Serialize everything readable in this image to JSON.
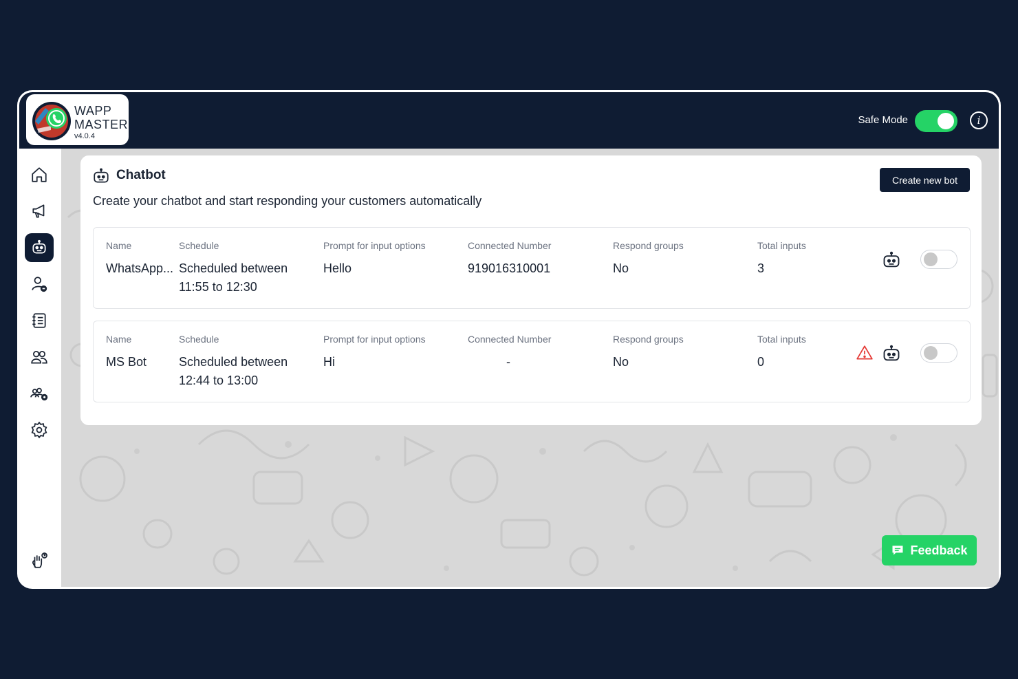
{
  "app": {
    "logo_line1": "WAPP",
    "logo_line2": "MASTER",
    "version": "v4.0.4",
    "safe_mode_label": "Safe Mode",
    "safe_mode_on": true
  },
  "sidebar": {
    "items": [
      {
        "icon": "home-icon",
        "active": false
      },
      {
        "icon": "megaphone-icon",
        "active": false
      },
      {
        "icon": "chatbot-icon",
        "active": true
      },
      {
        "icon": "user-minus-icon",
        "active": false
      },
      {
        "icon": "notebook-icon",
        "active": false
      },
      {
        "icon": "users-icon",
        "active": false
      },
      {
        "icon": "users-add-icon",
        "active": false
      },
      {
        "icon": "settings-icon",
        "active": false
      }
    ],
    "help_icon": "hand-help-icon"
  },
  "page": {
    "title": "Chatbot",
    "subtitle": "Create your chatbot and start responding your customers automatically",
    "create_button": "Create new bot"
  },
  "columns": {
    "name": "Name",
    "schedule": "Schedule",
    "prompt": "Prompt for input options",
    "connected": "Connected Number",
    "respond": "Respond groups",
    "total": "Total inputs"
  },
  "bots": [
    {
      "name": "WhatsApp...",
      "schedule_line1": "Scheduled between",
      "schedule_line2": "11:55 to 12:30",
      "prompt": "Hello",
      "connected": "919016310001",
      "respond": "No",
      "total": "3",
      "warning": false,
      "enabled": false
    },
    {
      "name": "MS Bot",
      "schedule_line1": "Scheduled between",
      "schedule_line2": "12:44 to 13:00",
      "prompt": "Hi",
      "connected": "-",
      "respond": "No",
      "total": "0",
      "warning": true,
      "enabled": false
    }
  ],
  "feedback_label": "Feedback",
  "colors": {
    "navy": "#0f1c33",
    "green": "#25d366",
    "warning_red": "#e53935"
  }
}
